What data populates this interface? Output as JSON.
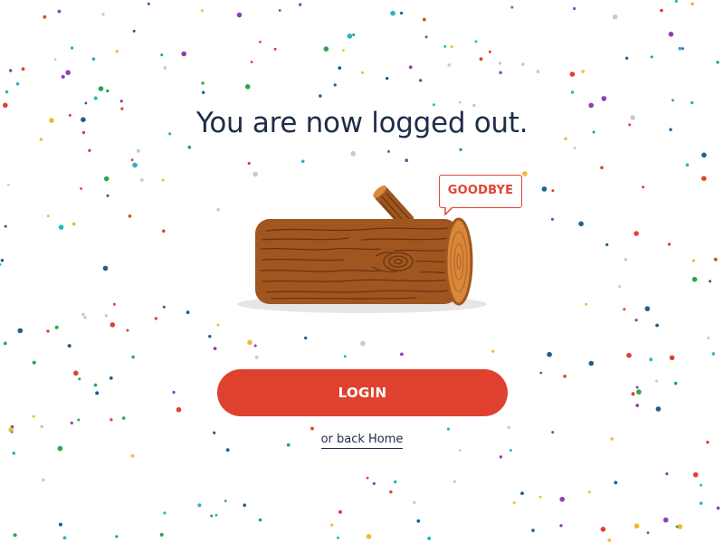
{
  "page": {
    "headline": "You are now logged out.",
    "bubble_text": "GOODBYE",
    "login_label": "LOGIN",
    "home_link_label": "or back Home"
  },
  "colors": {
    "background": "#ffffff",
    "headline_text": "#1e2d49",
    "accent_red": "#e0412e",
    "bark_brown": "#a0561f",
    "bark_dark": "#6b3410",
    "wood_end": "#d9883a",
    "confetti": [
      "#e0412e",
      "#1f5f8b",
      "#2aa64a",
      "#f3b82c",
      "#27b5c4",
      "#8e3fb0",
      "#c9c9c9"
    ]
  },
  "icons": {
    "illustration": "wooden-log-illustration",
    "bubble": "speech-bubble"
  }
}
